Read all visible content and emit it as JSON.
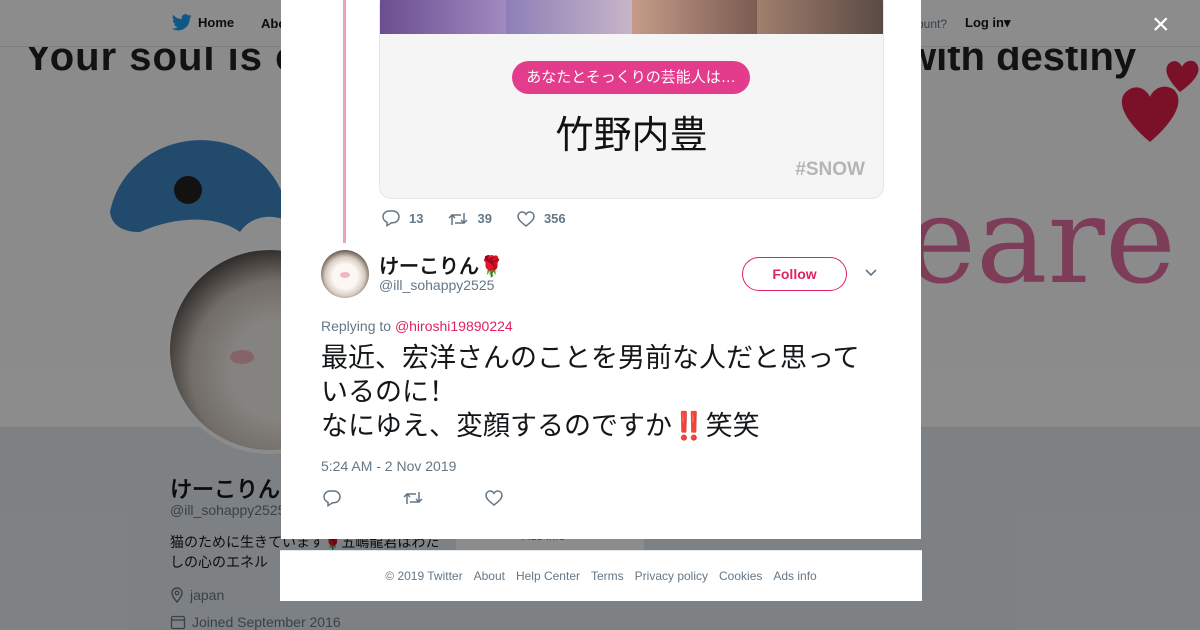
{
  "nav": {
    "home_label": "Home",
    "about_label": "Abo",
    "account_prompt": "ccount?",
    "login_label": "Log in"
  },
  "banner": {
    "text_left": "Your soul is c",
    "text_right": "with destiny",
    "scrawl": "eare"
  },
  "profile": {
    "name": "けーこりん",
    "handle": "@ill_sohappy2525",
    "bio": "猫のために生きています🌹五嶋龍君はわたしの心のエネル",
    "location": "japan",
    "joined": "Joined September 2016",
    "side_card_text": "Ads info"
  },
  "modal": {
    "close_icon": "×",
    "parent_tweet": {
      "media_pill": "あなたとそっくりの芸能人は…",
      "media_celebrity": "竹野内豊",
      "media_tag": "#SNOW",
      "replies": "13",
      "retweets": "39",
      "likes": "356"
    },
    "tweet": {
      "author_name": "けーこりん🌹",
      "author_handle": "@ill_sohappy2525",
      "follow_label": "Follow",
      "replying_prefix": "Replying to",
      "replying_handle": "@hiroshi19890224",
      "text_line1": "最近、宏洋さんのことを男前な人だと思って",
      "text_line2": "いるのに！",
      "text_line3_a": "なにゆえ、変顔するのですか",
      "text_line3_bang": "‼️",
      "text_line3_b": "笑笑",
      "timestamp": "5:24 AM - 2 Nov 2019"
    }
  },
  "footer": {
    "copyright": "© 2019 Twitter",
    "about": "About",
    "help": "Help Center",
    "terms": "Terms",
    "privacy": "Privacy policy",
    "cookies": "Cookies",
    "ads": "Ads info"
  },
  "colors": {
    "accent": "#e0245e",
    "pill": "#e33c8c",
    "thread_line": "#e8a3b8",
    "twitter_blue": "#1da1f2"
  }
}
